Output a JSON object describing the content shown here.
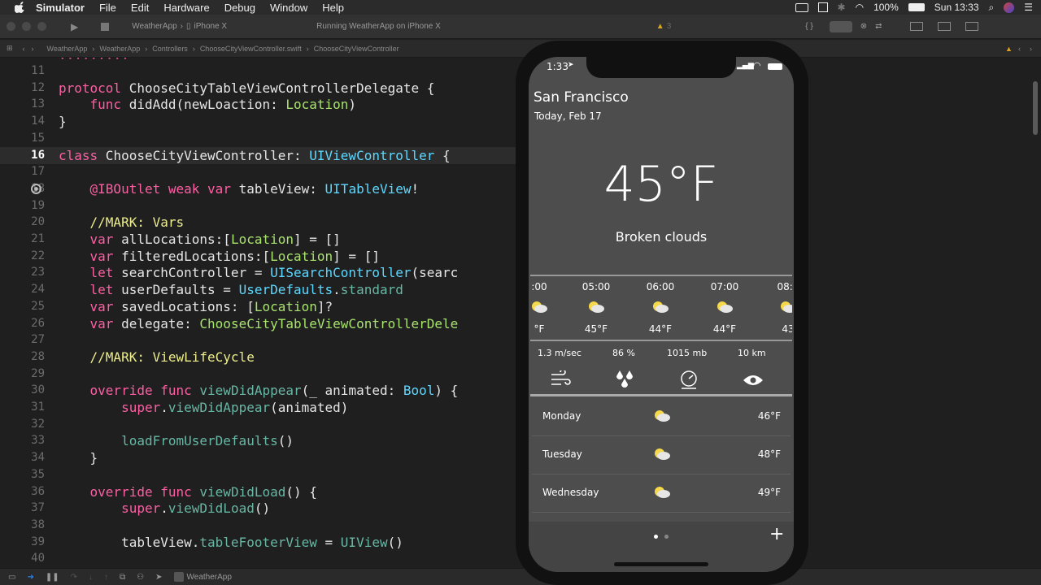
{
  "menubar": {
    "app_name": "Simulator",
    "items": [
      "File",
      "Edit",
      "Hardware",
      "Debug",
      "Window",
      "Help"
    ],
    "battery": "100%",
    "clock": "Sun 13:33"
  },
  "toolbar": {
    "scheme": "WeatherApp",
    "device": "iPhone X",
    "status": "Running WeatherApp on iPhone X",
    "warnings": "3"
  },
  "jumpbar": {
    "crumbs": [
      "WeatherApp",
      "WeatherApp",
      "Controllers",
      "ChooseCityViewController.swift",
      "ChooseCityViewController"
    ]
  },
  "editor": {
    "lines": [
      {
        "n": "11",
        "t": ""
      },
      {
        "n": "12",
        "t": "protocol ChooseCityTableViewControllerDelegate {"
      },
      {
        "n": "13",
        "t": "    func didAdd(newLoaction: Location)"
      },
      {
        "n": "14",
        "t": "}"
      },
      {
        "n": "15",
        "t": ""
      },
      {
        "n": "16",
        "t": "class ChooseCityViewController: UIViewController {"
      },
      {
        "n": "17",
        "t": ""
      },
      {
        "n": "18",
        "t": "    @IBOutlet weak var tableView: UITableView!"
      },
      {
        "n": "19",
        "t": ""
      },
      {
        "n": "20",
        "t": "    //MARK: Vars"
      },
      {
        "n": "21",
        "t": "    var allLocations:[Location] = []"
      },
      {
        "n": "22",
        "t": "    var filteredLocations:[Location] = []"
      },
      {
        "n": "23",
        "t": "    let searchController = UISearchController(searc"
      },
      {
        "n": "24",
        "t": "    let userDefaults = UserDefaults.standard"
      },
      {
        "n": "25",
        "t": "    var savedLocations: [Location]?"
      },
      {
        "n": "26",
        "t": "    var delegate: ChooseCityTableViewControllerDele"
      },
      {
        "n": "27",
        "t": ""
      },
      {
        "n": "28",
        "t": "    //MARK: ViewLifeCycle"
      },
      {
        "n": "29",
        "t": ""
      },
      {
        "n": "30",
        "t": "    override func viewDidAppear(_ animated: Bool) {"
      },
      {
        "n": "31",
        "t": "        super.viewDidAppear(animated)"
      },
      {
        "n": "32",
        "t": ""
      },
      {
        "n": "33",
        "t": "        loadFromUserDefaults()"
      },
      {
        "n": "34",
        "t": "    }"
      },
      {
        "n": "35",
        "t": ""
      },
      {
        "n": "36",
        "t": "    override func viewDidLoad() {"
      },
      {
        "n": "37",
        "t": "        super.viewDidLoad()"
      },
      {
        "n": "38",
        "t": ""
      },
      {
        "n": "39",
        "t": "        tableView.tableFooterView = UIView()"
      },
      {
        "n": "40",
        "t": ""
      }
    ]
  },
  "statusbar": {
    "target": "WeatherApp"
  },
  "phone": {
    "time": "1:33",
    "city": "San Francisco",
    "date": "Today, Feb 17",
    "temperature": "45°F",
    "condition": "Broken clouds",
    "hourly": [
      {
        "time": ":00",
        "temp": "°F"
      },
      {
        "time": "05:00",
        "temp": "45°F"
      },
      {
        "time": "06:00",
        "temp": "44°F"
      },
      {
        "time": "07:00",
        "temp": "44°F"
      },
      {
        "time": "08:0",
        "temp": "43"
      }
    ],
    "details": {
      "wind": "1.3 m/sec",
      "humidity": "86 %",
      "pressure": "1015 mb",
      "visibility": "10 km"
    },
    "daily": [
      {
        "day": "Monday",
        "temp": "46°F"
      },
      {
        "day": "Tuesday",
        "temp": "48°F"
      },
      {
        "day": "Wednesday",
        "temp": "49°F"
      }
    ],
    "add_label": "+"
  },
  "colors": {
    "keyword": "#fc5fa3",
    "type": "#5dd8ff",
    "comment": "#eded8e",
    "func": "#67b7a4",
    "sun": "#f6d94a"
  }
}
